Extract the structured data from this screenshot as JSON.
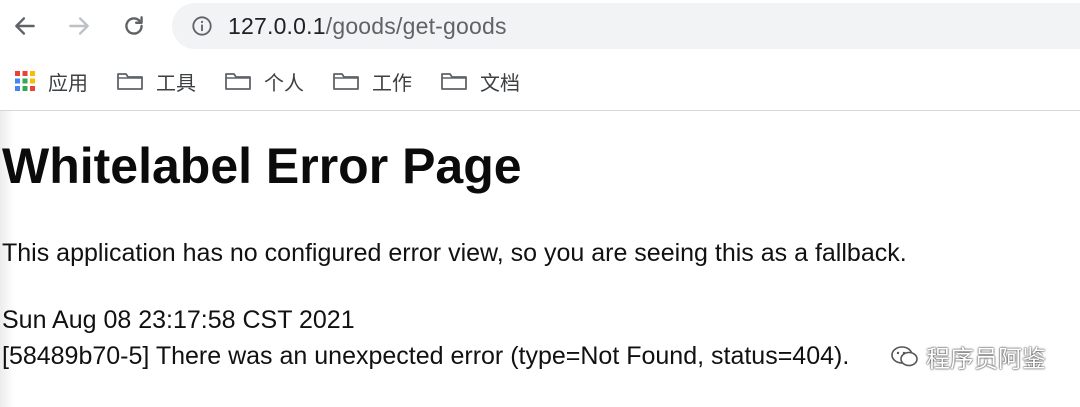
{
  "toolbar": {
    "url_host": "127.0.0.1",
    "url_path": "/goods/get-goods"
  },
  "bookmarks": {
    "items": [
      {
        "label": "应用",
        "icon": "apps-grid-icon"
      },
      {
        "label": "工具",
        "icon": "folder-icon"
      },
      {
        "label": "个人",
        "icon": "folder-icon"
      },
      {
        "label": "工作",
        "icon": "folder-icon"
      },
      {
        "label": "文档",
        "icon": "folder-icon"
      }
    ]
  },
  "page": {
    "title": "Whitelabel Error Page",
    "description": "This application has no configured error view, so you are seeing this as a fallback.",
    "timestamp": "Sun Aug 08 23:17:58 CST 2021",
    "detail": "[58489b70-5] There was an unexpected error (type=Not Found, status=404)."
  },
  "watermark": {
    "text": "程序员阿鉴"
  },
  "colors": {
    "toolbar_bg": "#ffffff",
    "address_bar_bg": "#f1f3f4",
    "text_primary": "#111111",
    "url_path": "#5f6368"
  }
}
